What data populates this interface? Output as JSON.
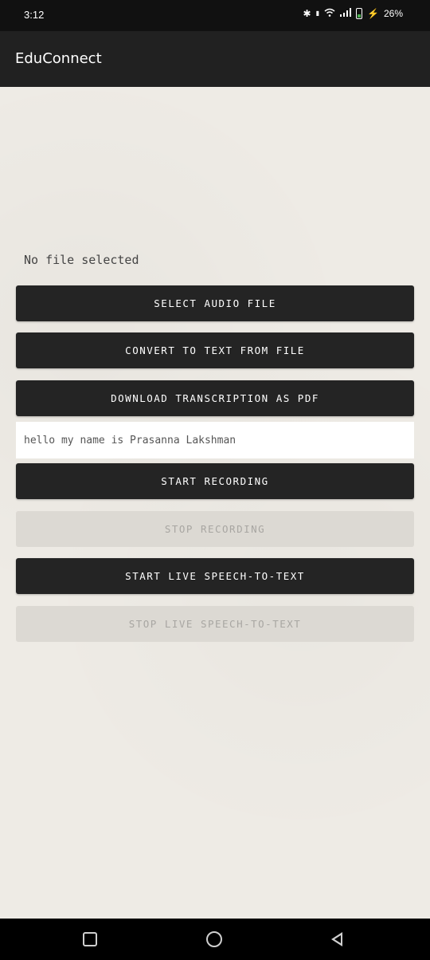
{
  "status_bar": {
    "time": "3:12",
    "battery": "26%",
    "icons": [
      "bluetooth-icon",
      "nr-icon",
      "wifi-icon",
      "signal-icon",
      "battery-icon",
      "charging-icon"
    ]
  },
  "app": {
    "title": "EduConnect"
  },
  "main": {
    "file_status": "No file selected",
    "select_audio_label": "SELECT AUDIO FILE",
    "convert_label": "CONVERT TO TEXT FROM FILE",
    "download_pdf_label": "DOWNLOAD TRANSCRIPTION AS PDF",
    "transcription_value": "hello my name is Prasanna Lakshman",
    "start_recording_label": "START RECORDING",
    "stop_recording_label": "STOP RECORDING",
    "start_live_label": "START LIVE SPEECH-TO-TEXT",
    "stop_live_label": "STOP LIVE SPEECH-TO-TEXT"
  },
  "colors": {
    "button_dark": "#242424",
    "button_disabled": "#dcd9d3",
    "appbar": "#212121",
    "background": "#eeebe5"
  }
}
